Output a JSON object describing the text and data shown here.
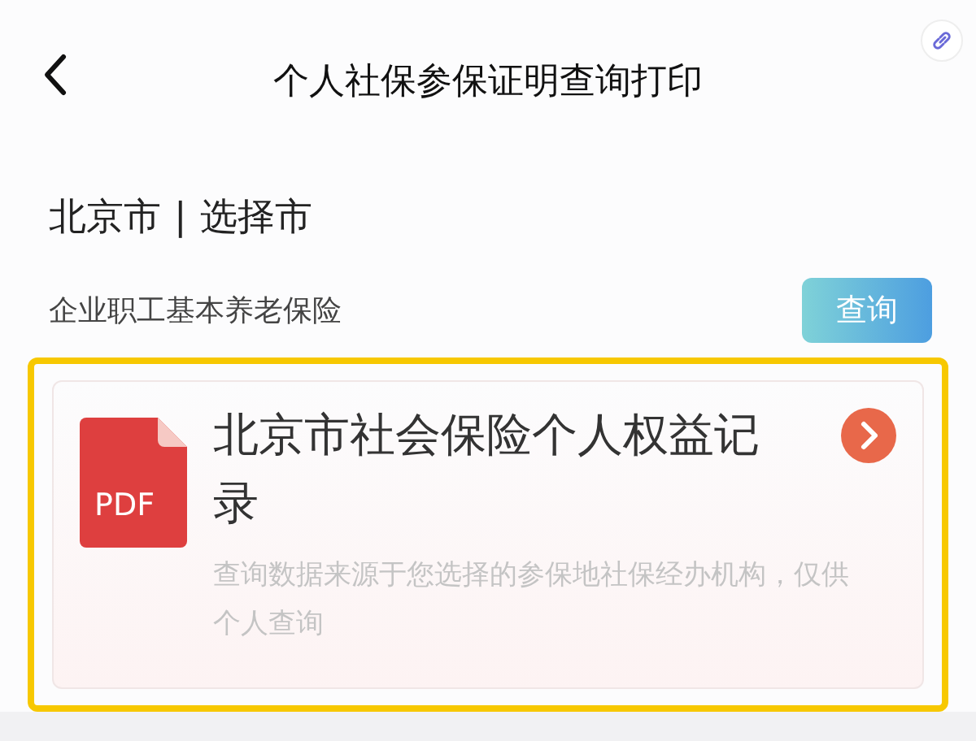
{
  "header": {
    "title": "个人社保参保证明查询打印"
  },
  "city": {
    "current": "北京市",
    "separator": "|",
    "action": "选择市"
  },
  "insurance": {
    "name": "企业职工基本养老保险",
    "button": "查询"
  },
  "record": {
    "highlighted": true,
    "file_type": "PDF",
    "title": "北京市社会保险个人权益记录",
    "description": "查询数据来源于您选择的参保地社保经办机构，仅供个人查询"
  }
}
